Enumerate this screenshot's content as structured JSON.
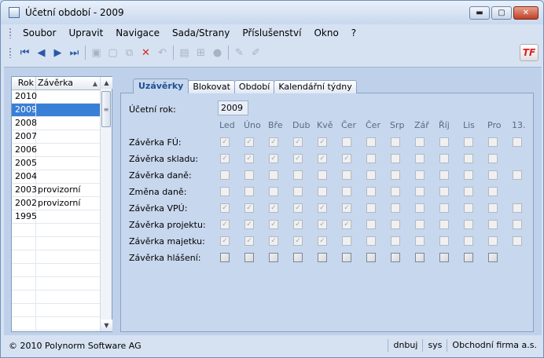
{
  "window": {
    "title": "Účetní období - 2009",
    "controls": {
      "minimize": "▬",
      "maximize": "▢",
      "close": "✕"
    }
  },
  "menu": [
    "Soubor",
    "Upravit",
    "Navigace",
    "Sada/Strany",
    "Příslušenství",
    "Okno",
    "?"
  ],
  "toolbar": {
    "icons": [
      {
        "name": "first-record-icon",
        "glyph": "⏮",
        "enabled": true
      },
      {
        "name": "prev-record-icon",
        "glyph": "◀",
        "enabled": true
      },
      {
        "name": "next-record-icon",
        "glyph": "▶",
        "enabled": true
      },
      {
        "name": "last-record-icon",
        "glyph": "⏭",
        "enabled": true
      },
      {
        "name": "save-icon",
        "glyph": "▣",
        "enabled": false
      },
      {
        "name": "new-icon",
        "glyph": "▢",
        "enabled": false
      },
      {
        "name": "copy-icon",
        "glyph": "⧉",
        "enabled": false
      },
      {
        "name": "delete-icon",
        "glyph": "✕",
        "enabled": true
      },
      {
        "name": "undo-icon",
        "glyph": "↶",
        "enabled": false
      },
      {
        "name": "print-icon",
        "glyph": "▤",
        "enabled": false
      },
      {
        "name": "tree-icon",
        "glyph": "⊞",
        "enabled": false
      },
      {
        "name": "stop-icon",
        "glyph": "●",
        "enabled": false
      },
      {
        "name": "edit-icon",
        "glyph": "✎",
        "enabled": false
      },
      {
        "name": "edit-alt-icon",
        "glyph": "✐",
        "enabled": false
      }
    ],
    "logo": "TF"
  },
  "yearlist": {
    "headers": {
      "rok": "Rok",
      "zaverka": "Závěrka"
    },
    "rows": [
      {
        "rok": "2010",
        "zaverka": ""
      },
      {
        "rok": "2009",
        "zaverka": ""
      },
      {
        "rok": "2008",
        "zaverka": ""
      },
      {
        "rok": "2007",
        "zaverka": ""
      },
      {
        "rok": "2006",
        "zaverka": ""
      },
      {
        "rok": "2005",
        "zaverka": ""
      },
      {
        "rok": "2004",
        "zaverka": ""
      },
      {
        "rok": "2003",
        "zaverka": "provizorní"
      },
      {
        "rok": "2002",
        "zaverka": "provizorní"
      },
      {
        "rok": "1995",
        "zaverka": ""
      }
    ],
    "selected_index": 1,
    "empty_rows": 8
  },
  "tabs": [
    "Uzávěrky",
    "Blokovat",
    "Období",
    "Kalendářní týdny"
  ],
  "active_tab": 0,
  "panel": {
    "year_label": "Účetní rok:",
    "year_value": "2009",
    "months": [
      "Led",
      "Úno",
      "Bře",
      "Dub",
      "Kvě",
      "Čer",
      "Čer",
      "Srp",
      "Zář",
      "Říj",
      "Lis",
      "Pro",
      "13."
    ],
    "rows": [
      {
        "label": "Závěrka FÚ:",
        "checked": [
          1,
          1,
          1,
          1,
          1,
          0,
          0,
          0,
          0,
          0,
          0,
          0,
          0
        ],
        "cells": 13,
        "style": "dis"
      },
      {
        "label": "Závěrka skladu:",
        "checked": [
          1,
          1,
          1,
          1,
          1,
          1,
          0,
          0,
          0,
          0,
          0,
          0
        ],
        "cells": 12,
        "style": "dis"
      },
      {
        "label": "Závěrka daně:",
        "checked": [
          0,
          0,
          0,
          0,
          0,
          0,
          0,
          0,
          0,
          0,
          0,
          0,
          0
        ],
        "cells": 13,
        "style": "dis"
      },
      {
        "label": "Změna daně:",
        "checked": [
          0,
          0,
          0,
          0,
          0,
          0,
          0,
          0,
          0,
          0,
          0,
          0
        ],
        "cells": 12,
        "style": "dis"
      },
      {
        "label": "Závěrka VPÚ:",
        "checked": [
          1,
          1,
          1,
          1,
          1,
          1,
          0,
          0,
          0,
          0,
          0,
          0,
          0
        ],
        "cells": 13,
        "style": "dis"
      },
      {
        "label": "Závěrka projektu:",
        "checked": [
          1,
          1,
          1,
          1,
          1,
          1,
          0,
          0,
          0,
          0,
          0,
          0,
          0
        ],
        "cells": 13,
        "style": "dis"
      },
      {
        "label": "Závěrka majetku:",
        "checked": [
          1,
          1,
          1,
          1,
          1,
          0,
          0,
          0,
          0,
          0,
          0,
          0,
          0
        ],
        "cells": 13,
        "style": "dis"
      },
      {
        "label": "Závěrka hlášení:",
        "checked": [
          0,
          0,
          0,
          0,
          0,
          0,
          0,
          0,
          0,
          0,
          0,
          0
        ],
        "cells": 12,
        "style": "dark"
      }
    ]
  },
  "status": {
    "copyright": "© 2010 Polynorm Software AG",
    "db": "dnbuj",
    "user": "sys",
    "company": "Obchodní firma a.s."
  }
}
